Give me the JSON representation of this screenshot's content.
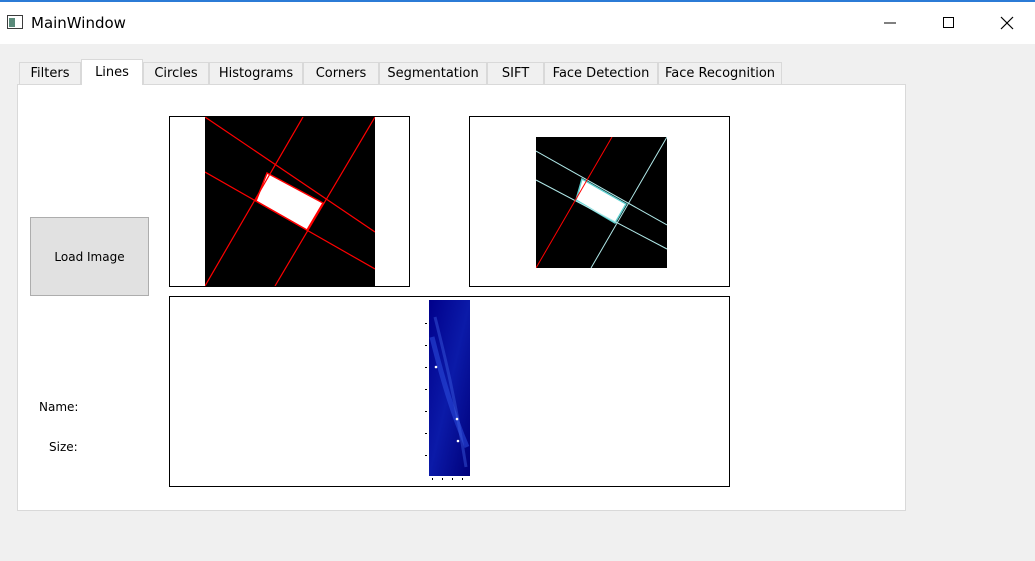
{
  "window": {
    "title": "MainWindow"
  },
  "tabs": [
    {
      "label": "Filters",
      "active": false
    },
    {
      "label": "Lines",
      "active": true
    },
    {
      "label": "Circles",
      "active": false
    },
    {
      "label": "Histograms",
      "active": false
    },
    {
      "label": "Corners",
      "active": false
    },
    {
      "label": "Segmentation",
      "active": false
    },
    {
      "label": "SIFT",
      "active": false
    },
    {
      "label": "Face Detection",
      "active": false
    },
    {
      "label": "Face Recognition",
      "active": false
    }
  ],
  "lines_tab": {
    "load_button_label": "Load Image",
    "name_label": "Name:",
    "size_label": "Size:"
  },
  "colors": {
    "detected_line": "#ff0000",
    "hough_background": "#00008b",
    "window_accent": "#2b7bd6"
  }
}
